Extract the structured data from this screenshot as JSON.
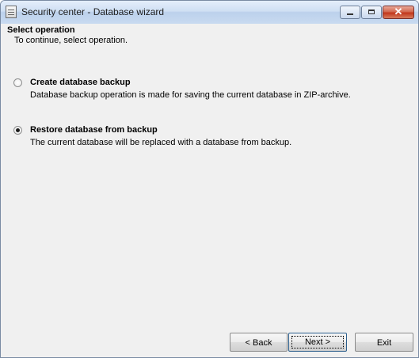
{
  "window": {
    "title": "Security center - Database wizard"
  },
  "titlebar_buttons": {
    "close_glyph": "✕"
  },
  "page": {
    "heading": "Select operation",
    "subheading": "To continue, select operation."
  },
  "options": [
    {
      "label": "Create database backup",
      "description": "Database backup operation is made for saving the current database in ZIP-archive.",
      "selected": false
    },
    {
      "label": "Restore database from backup",
      "description": "The current database will be replaced with a database from backup.",
      "selected": true
    }
  ],
  "buttons": {
    "back": "< Back",
    "next": "Next >",
    "exit": "Exit"
  }
}
